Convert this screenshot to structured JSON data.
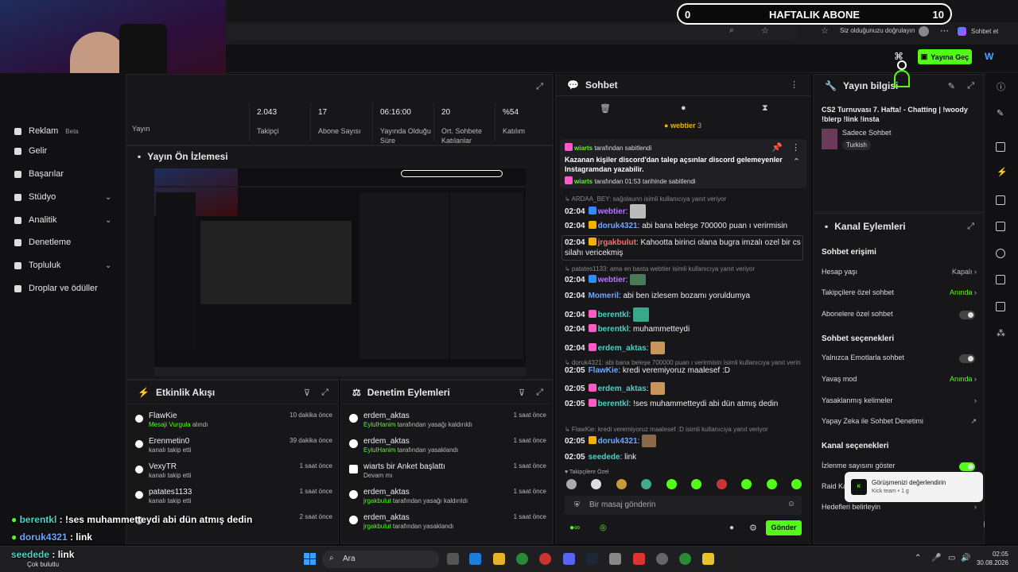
{
  "abone_bar": {
    "left": "0",
    "title": "HAFTALIK ABONE",
    "right": "10"
  },
  "browser": {
    "signin_text": "Siz olduğunuzu doğrulayın",
    "chat_label": "Sohbet et"
  },
  "header": {
    "go_live": "Yayına Geç"
  },
  "sidebar": {
    "items": [
      {
        "label": "Reklam",
        "badge": "Beta"
      },
      {
        "label": "Gelir"
      },
      {
        "label": "Başarılar"
      },
      {
        "label": "Stüdyo"
      },
      {
        "label": "Analitik"
      },
      {
        "label": "Denetleme"
      },
      {
        "label": "Topluluk"
      },
      {
        "label": "Droplar ve ödüller"
      }
    ]
  },
  "stats": {
    "partial_labels": [
      "Yayın",
      "..."
    ],
    "items": [
      {
        "value": "2.043",
        "label": "Takipçi"
      },
      {
        "value": "17",
        "label": "Abone Sayısı"
      },
      {
        "value": "06:16:00",
        "label": "Yayında Olduğu Süre"
      },
      {
        "value": "20",
        "label": "Ort. Sohbete Katılanlar"
      },
      {
        "value": "%54",
        "label": "Katılım"
      }
    ]
  },
  "preview": {
    "title": "Yayın Ön İzlemesi"
  },
  "activity": {
    "title": "Etkinlik Akışı",
    "rows": [
      {
        "name": "FlawKie",
        "sub": "Mesaji Vurgula",
        "sub2": " alındı",
        "time": "10 dakika önce"
      },
      {
        "name": "Erenmetin0",
        "sub": "kanalı takip etti",
        "sub2": "",
        "time": "39 dakika önce"
      },
      {
        "name": "VexyTR",
        "sub": "kanalı takip etti",
        "sub2": "",
        "time": "1 saat önce"
      },
      {
        "name": "patates1133",
        "sub": "kanalı takip etti",
        "sub2": "",
        "time": "1 saat önce"
      },
      {
        "name": "",
        "sub": "",
        "sub2": "",
        "time": "2 saat önce"
      }
    ]
  },
  "moderation": {
    "title": "Denetim Eylemleri",
    "rows": [
      {
        "name": "erdem_aktas",
        "sub_user": "EylulHanim",
        "sub": " tarafından yasağı kaldırıldı",
        "time": "1 saat önce"
      },
      {
        "name": "erdem_aktas",
        "sub_user": "EylulHanim",
        "sub": " tarafından yasaklandı",
        "time": "1 saat önce"
      },
      {
        "name": "wiarts bir Anket başlattı",
        "sub_user": "",
        "sub": "Devam mı",
        "time": "1 saat önce"
      },
      {
        "name": "erdem_aktas",
        "sub_user": "jrgakbulut",
        "sub": " tarafından yasağı kaldırıldı",
        "time": "1 saat önce"
      },
      {
        "name": "erdem_aktas",
        "sub_user": "jrgakbulut",
        "sub": " tarafından yasaklandı",
        "time": "1 saat önce"
      }
    ]
  },
  "chat": {
    "title": "Sohbet",
    "top_user": "webtier",
    "top_count": "3",
    "pinned": {
      "by_user": "wiarts",
      "by_text": " tarafından sabitlendi",
      "text": "Kazanan kişiler discord'dan talep açsınlar discord gelemeyenler Instagramdan yazabilir.",
      "footer_user": "wiarts",
      "footer_text": " tarafından 01:53 tarihinde sabitlendi"
    },
    "replies": [
      "↳ ARDAA_BEY: sağolaunn isimli kullanıcıya yanıt veriyor",
      "↳ patates1133: ama en basta webtier isimli kullanıcıya yanıt veriyor",
      "↳ doruk4321: abi bana beleşe 700000 puan ı verirmisin isimli kullanıcıya yanıt verin",
      "↳ FlawKie: kredi veremiyoruz maalesef :D isimli kullanıcıya yanıt veriyor"
    ],
    "messages": [
      {
        "time": "02:04",
        "user": "webtier",
        "text": ":",
        "color": "#b678ff"
      },
      {
        "time": "02:04",
        "user": "doruk4321",
        "text": ": abi bana beleşe 700000 puan ı verirmisin",
        "color": "#6ea7ff"
      },
      {
        "time": "02:04",
        "user": "jrgakbulut",
        "text": ": Kahootta birinci olana bugra imzalı ozel bir cs silahı vericekmiş",
        "color": "#ff6b6b"
      },
      {
        "time": "02:04",
        "user": "webtier",
        "text": ":",
        "color": "#b678ff"
      },
      {
        "time": "02:04",
        "user": "Momeril",
        "text": ": abi ben izlesem bozamı yoruldumya",
        "color": "#6ea7ff"
      },
      {
        "time": "02:04",
        "user": "berentkl",
        "text": ":",
        "color": "#4fd1c5"
      },
      {
        "time": "02:04",
        "user": "berentkl",
        "text": ": muhammetteydi",
        "color": "#4fd1c5"
      },
      {
        "time": "02:04",
        "user": "erdem_aktas",
        "text": ":",
        "color": "#4fd1c5"
      },
      {
        "time": "02:05",
        "user": "FlawKie",
        "text": ": kredi veremiyoruz maalesef :D",
        "color": "#6ea7ff"
      },
      {
        "time": "02:05",
        "user": "erdem_aktas",
        "text": ":",
        "color": "#4fd1c5"
      },
      {
        "time": "02:05",
        "user": "berentkl",
        "text": ": !ses muhammetteydi abi dün atmış dedin",
        "color": "#4fd1c5"
      },
      {
        "time": "02:05",
        "user": "doruk4321",
        "text": ":",
        "color": "#6ea7ff"
      },
      {
        "time": "02:05",
        "user": "seedede",
        "text": ": link",
        "color": "#4fd1c5"
      }
    ],
    "followers_only": "Takipçilere Özel",
    "placeholder": "Bir masaj gönderin",
    "send": "Gönder"
  },
  "stream_info": {
    "title": "Yayın bilgisi",
    "stream_title": "CS2 Turnuvası 7. Hafta! - Chatting | !woody !blerp !link !insta",
    "category": "Sadece Sohbet",
    "tag": "Turkish"
  },
  "channel_actions": {
    "title": "Kanal Eylemleri",
    "sec1": "Sohbet erişimi",
    "account_age": "Hesap yaşı",
    "account_age_val": "Kapalı",
    "followers_chat": "Takipçilere özel sohbet",
    "followers_chat_val": "Anında",
    "subs_chat": "Abonelere özel sohbet",
    "sec2": "Sohbet seçenekleri",
    "emote_only": "Yalnızca Emotlarla sohbet",
    "slow_mode": "Yavaş mod",
    "slow_mode_val": "Anında",
    "banned_words": "Yasaklanmış kelimeler",
    "ai_mod": "Yapay Zeka ile Sohbet Denetimi",
    "sec3": "Kanal seçenekleri",
    "show_viewers": "İzlenme sayısını göster",
    "raid": "Raid Ka...",
    "goals": "Hedefleri belirleyin"
  },
  "toast": {
    "title": "Görüşmenizi değerlendirin",
    "sub": "Kick team • 1 g"
  },
  "overlay": {
    "line1_user": "berentkl",
    "line1_text": " : !ses muhammetteydi abi dün atmış dedin",
    "line2_user": "doruk4321",
    "line2_text": " : link"
  },
  "taskbar": {
    "weather_name": "seedede",
    "weather_text": " : link",
    "weather_sub": "Çok bulutlu",
    "search": "Ara",
    "time": "02:05",
    "date": "30.08.2026"
  },
  "colors": {
    "accent": "#53fc18",
    "bg": "#17171a"
  }
}
